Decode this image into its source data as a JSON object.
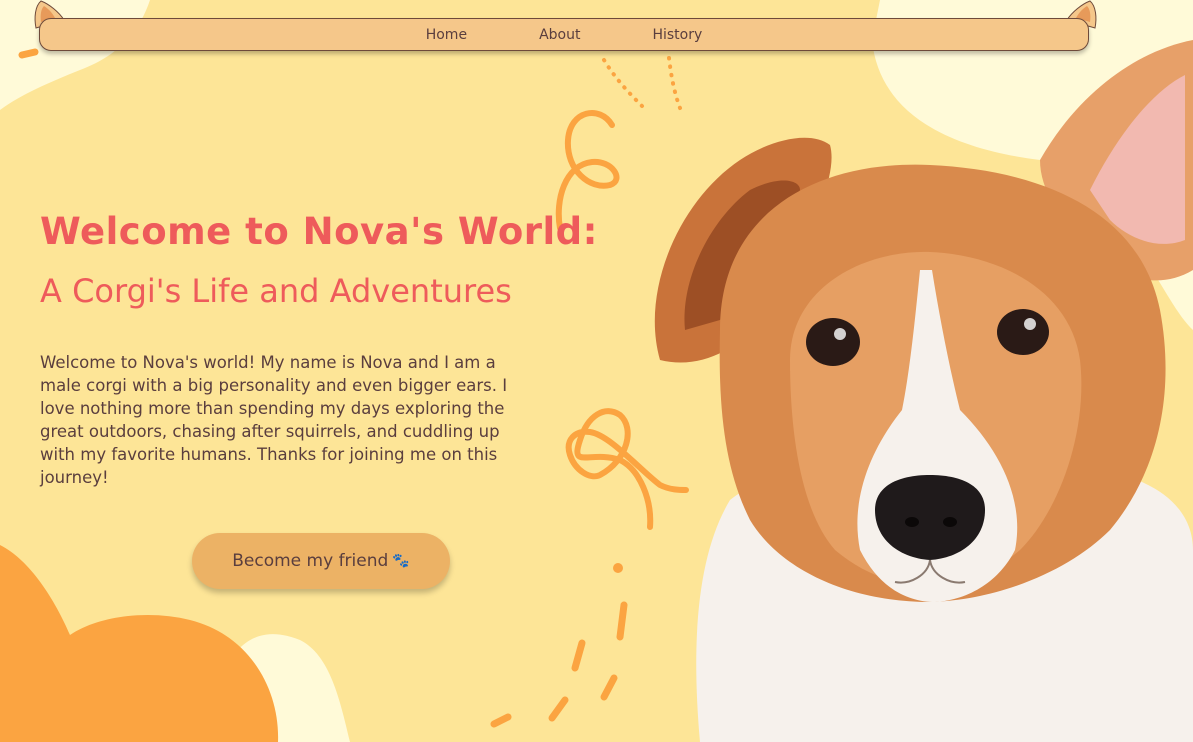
{
  "nav": {
    "items": [
      {
        "label": "Home"
      },
      {
        "label": "About"
      },
      {
        "label": "History"
      }
    ]
  },
  "hero": {
    "title": "Welcome to Nova's World:",
    "subtitle": "A Corgi's Life and Adventures",
    "intro": "Welcome to Nova's world! My name is Nova and I am a male corgi with a big personality and even bigger ears. I love nothing more than spending my days exploring the great outdoors, chasing after squirrels, and cuddling up with my favorite humans. Thanks for joining me on this journey!",
    "cta_label": "Become my friend",
    "cta_icon": "paw-icon"
  },
  "colors": {
    "background": "#fde597",
    "accent_red": "#ee5b5b",
    "nav_bg": "#f5c78a",
    "orange": "#fba441",
    "text": "#5a3e3e"
  }
}
